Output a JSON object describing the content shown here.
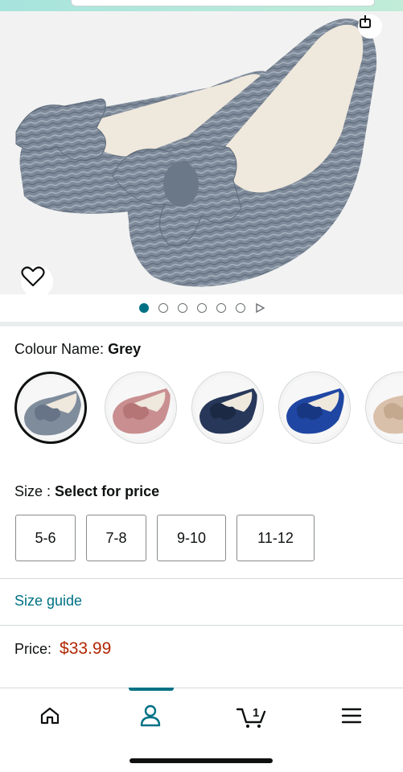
{
  "product": {
    "image_alt": "Grey velvet ballet slippers with bow",
    "carousel": {
      "total_dots": 6,
      "active_index": 0
    }
  },
  "colour": {
    "label": "Colour Name:",
    "selected": "Grey",
    "swatches": [
      {
        "name": "Grey",
        "color": "#7f8c9c",
        "selected": true
      },
      {
        "name": "Pink",
        "color": "#c98f90",
        "selected": false
      },
      {
        "name": "Navy",
        "color": "#27375a",
        "selected": false
      },
      {
        "name": "Royal Blue",
        "color": "#1f46a3",
        "selected": false
      },
      {
        "name": "Beige",
        "color": "#d9c0aa",
        "selected": false
      }
    ]
  },
  "size": {
    "label": "Size :",
    "prompt": "Select for price",
    "options": [
      "5-6",
      "7-8",
      "9-10",
      "11-12"
    ]
  },
  "size_guide": {
    "label": "Size guide"
  },
  "price": {
    "label": "Price:",
    "value": "$33.99"
  },
  "nav": {
    "items": [
      {
        "name": "home",
        "icon": "home-icon"
      },
      {
        "name": "account",
        "icon": "user-icon",
        "active": true
      },
      {
        "name": "cart",
        "icon": "cart-icon",
        "badge": "1"
      },
      {
        "name": "menu",
        "icon": "menu-icon"
      }
    ]
  },
  "colors": {
    "accent": "#007185",
    "price": "#b12704",
    "text": "#0f1111"
  }
}
